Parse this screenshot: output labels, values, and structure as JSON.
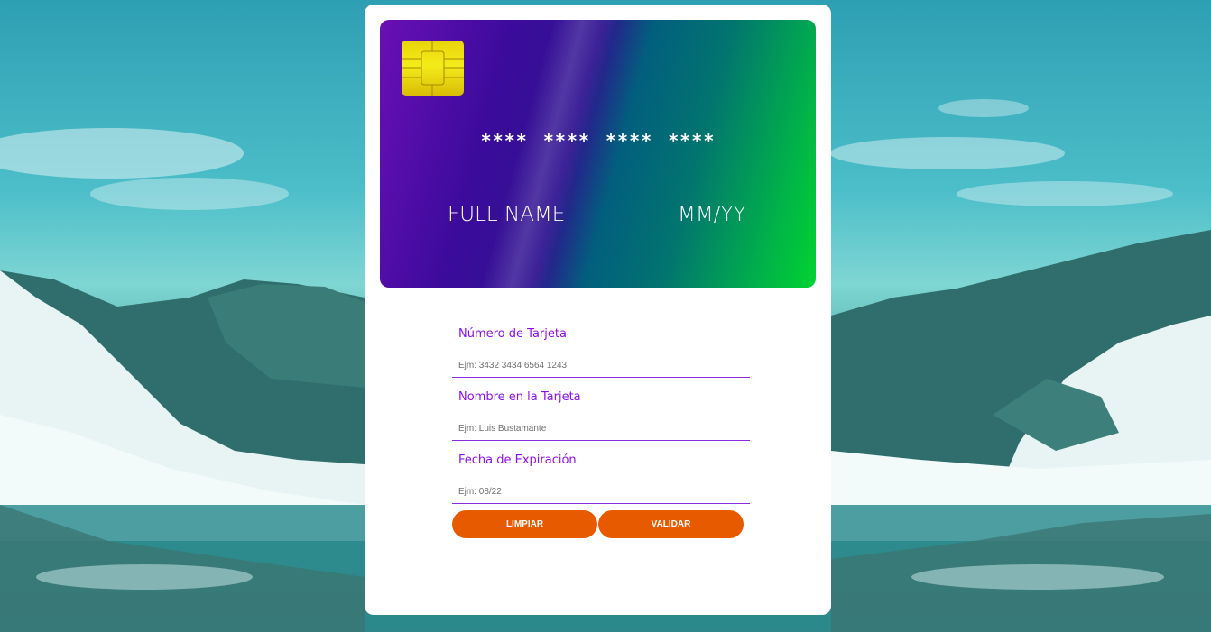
{
  "card": {
    "number": "**** **** **** ****",
    "name": "FULL NAME",
    "expiry": "MM/YY"
  },
  "form": {
    "card_number": {
      "label": "Número de Tarjeta",
      "placeholder": "Ejm: 3432 3434 6564 1243",
      "value": ""
    },
    "card_name": {
      "label": "Nombre en la Tarjeta",
      "placeholder": "Ejm: Luis Bustamante",
      "value": ""
    },
    "expiry": {
      "label": "Fecha de Expiración",
      "placeholder": "Ejm: 08/22",
      "value": ""
    }
  },
  "buttons": {
    "clear_label": "LIMPIAR",
    "validate_label": "VALIDAR"
  },
  "colors": {
    "accent": "#9010e8",
    "button": "#e85a00",
    "card_start": "#6a0fb5",
    "card_end": "#00d430"
  }
}
